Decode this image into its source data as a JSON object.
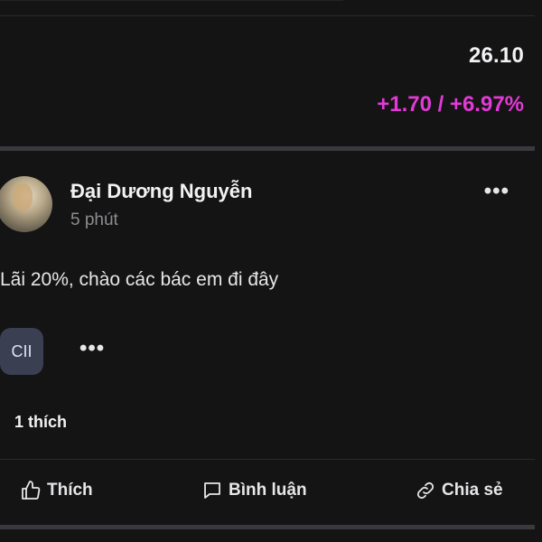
{
  "quote": {
    "price": "26.10",
    "change": "+1.70 / +6.97%",
    "change_color": "#e23ad6"
  },
  "post": {
    "author": "Đại Dương Nguyễn",
    "time": "5 phút",
    "text": "Lãi 20%, chào các bác em đi đây",
    "ticker": "CII",
    "more_label": "•••",
    "likes": "1 thích"
  },
  "actions": {
    "like": "Thích",
    "comment": "Bình luận",
    "share": "Chia sẻ"
  },
  "icons": {
    "like": "thumbs-up-icon",
    "comment": "comment-icon",
    "share": "link-icon",
    "more": "more-dots-icon"
  }
}
